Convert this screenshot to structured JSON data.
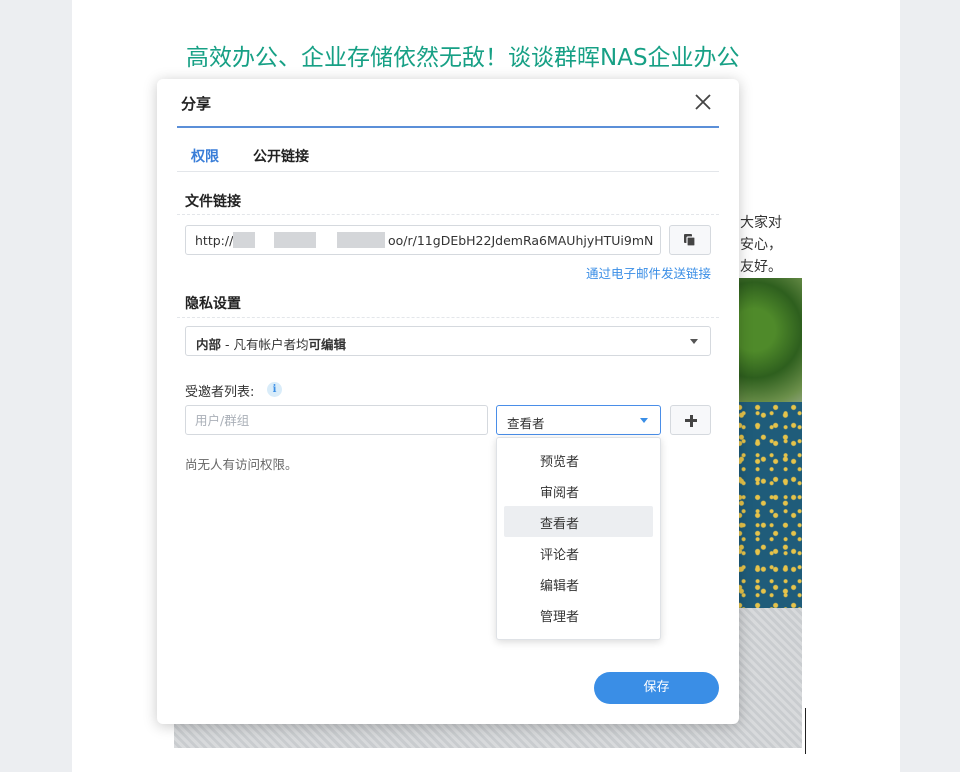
{
  "document": {
    "title": "高效办公、企业存储依然无敌！谈谈群晖NAS企业办公",
    "side_text": [
      "大家对",
      "安心，",
      "友好。"
    ]
  },
  "dialog": {
    "title": "分享",
    "tabs": [
      {
        "label": "权限",
        "active": true
      },
      {
        "label": "公开链接",
        "active": false
      }
    ],
    "file_link": {
      "section_title": "文件链接",
      "url_prefix": "http://",
      "url_suffix": "oo/r/11gDEbH22JdemRa6MAUhjyHTUi9mN",
      "email_link": "通过电子邮件发送链接"
    },
    "privacy": {
      "section_title": "隐私设置",
      "selected_bold": "内部",
      "selected_rest": " - 凡有帐户者均",
      "selected_emphasis": "可编辑"
    },
    "invitees": {
      "label": "受邀者列表:",
      "input_placeholder": "用户/群组",
      "role_selected": "查看者",
      "empty_text": "尚无人有访问权限。"
    },
    "role_options": [
      {
        "label": "预览者",
        "selected": false
      },
      {
        "label": "审阅者",
        "selected": false
      },
      {
        "label": "查看者",
        "selected": true
      },
      {
        "label": "评论者",
        "selected": false
      },
      {
        "label": "编辑者",
        "selected": false
      },
      {
        "label": "管理者",
        "selected": false
      }
    ],
    "save_label": "保存"
  },
  "colors": {
    "accent": "#3a8ee6",
    "tab_active": "#3a7ed8",
    "title_green": "#17a085"
  }
}
